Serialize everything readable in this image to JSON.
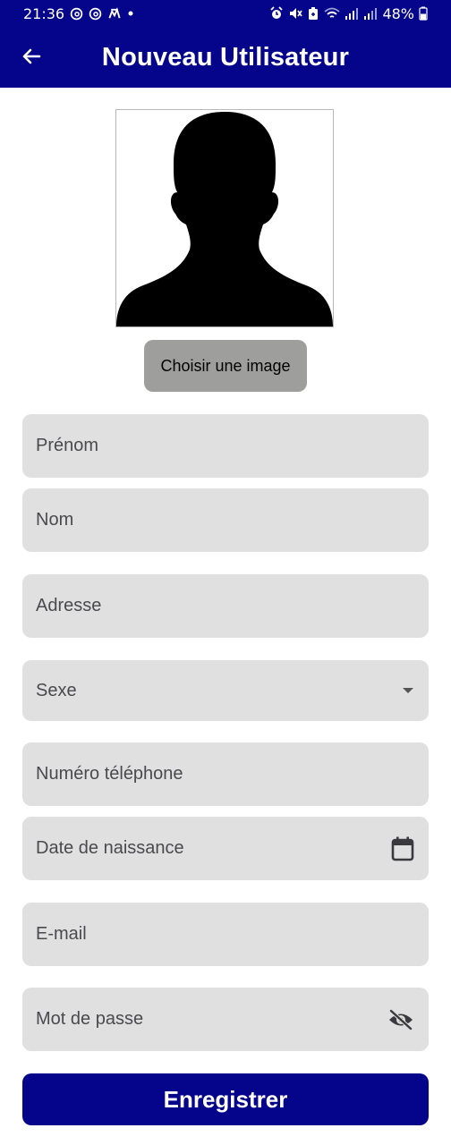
{
  "status_bar": {
    "time": "21:36",
    "battery": "48%",
    "left_icons": [
      "threads-icon",
      "threads-icon",
      "activity-icon",
      "dot-icon"
    ],
    "right_icons": [
      "alarm-icon",
      "mute-icon",
      "battery-saver-icon",
      "wifi-icon",
      "signal-icon",
      "signal-icon",
      "battery-icon"
    ]
  },
  "app_bar": {
    "title": "Nouveau Utilisateur",
    "back_icon": "arrow-left-icon",
    "background": "#05058c"
  },
  "avatar": {
    "icon": "person-silhouette-icon"
  },
  "choose_image_button": {
    "label": "Choisir une image",
    "background": "#9e9e9c"
  },
  "form": {
    "first_name": {
      "placeholder": "Prénom",
      "value": ""
    },
    "last_name": {
      "placeholder": "Nom",
      "value": ""
    },
    "address": {
      "placeholder": "Adresse",
      "value": ""
    },
    "sex": {
      "placeholder": "Sexe",
      "selected": "",
      "icon": "dropdown-arrow-icon"
    },
    "phone": {
      "placeholder": "Numéro téléphone",
      "value": ""
    },
    "birth_date": {
      "placeholder": "Date de naissance",
      "value": "",
      "icon": "calendar-icon"
    },
    "email": {
      "placeholder": "E-mail",
      "value": ""
    },
    "password": {
      "placeholder": "Mot de passe",
      "value": "",
      "icon": "eye-off-icon"
    },
    "field_background": "#e0e0e0"
  },
  "save_button": {
    "label": "Enregistrer",
    "background": "#05058c"
  }
}
